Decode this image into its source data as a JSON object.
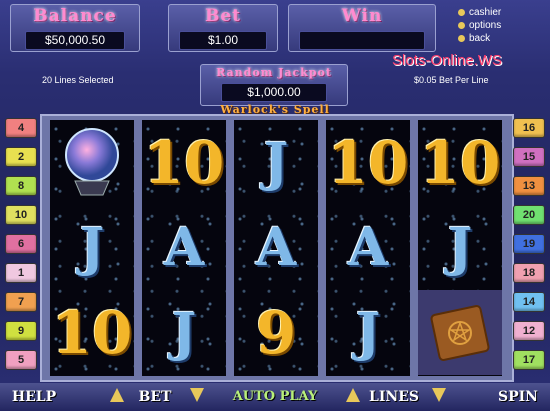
{
  "header": {
    "balance_label": "Balance",
    "balance_value": "$50,000.50",
    "bet_label": "Bet",
    "bet_value": "$1.00",
    "win_label": "Win",
    "win_value": ""
  },
  "menu": {
    "items": [
      {
        "label": "cashier"
      },
      {
        "label": "options"
      },
      {
        "label": "back"
      }
    ]
  },
  "site": "Slots-Online.WS",
  "lines_selected": "20 Lines Selected",
  "bet_per_line": "$0.05 Bet Per Line",
  "jackpot": {
    "label": "Random Jackpot",
    "value": "$1,000.00"
  },
  "game_title": "Warlock's Spell",
  "left_lines": [
    "4",
    "2",
    "8",
    "10",
    "6",
    "1",
    "7",
    "9",
    "5"
  ],
  "right_lines": [
    "16",
    "15",
    "13",
    "20",
    "19",
    "18",
    "14",
    "12",
    "17"
  ],
  "reels": [
    [
      {
        "sym": "crystal-ball-icon"
      },
      {
        "sym": "J",
        "style": "blue"
      },
      {
        "sym": "10",
        "style": "gold"
      }
    ],
    [
      {
        "sym": "10",
        "style": "gold"
      },
      {
        "sym": "A",
        "style": "blue"
      },
      {
        "sym": "J",
        "style": "blue"
      }
    ],
    [
      {
        "sym": "J",
        "style": "blue"
      },
      {
        "sym": "A",
        "style": "blue"
      },
      {
        "sym": "9",
        "style": "gold"
      }
    ],
    [
      {
        "sym": "10",
        "style": "gold"
      },
      {
        "sym": "A",
        "style": "blue"
      },
      {
        "sym": "J",
        "style": "blue"
      }
    ],
    [
      {
        "sym": "10",
        "style": "gold"
      },
      {
        "sym": "J",
        "style": "blue"
      },
      {
        "sym": "spell-book-icon"
      }
    ]
  ],
  "buttons": {
    "help": "HELP",
    "bet": "BET",
    "autoplay": "AUTO PLAY",
    "lines": "LINES",
    "spin": "SPIN"
  },
  "colors": {
    "header_text": "#ff8ad0",
    "gold_symbol": "#f3b62a",
    "blue_symbol": "#7fb8e8",
    "site_text": "#ff3e6e"
  }
}
